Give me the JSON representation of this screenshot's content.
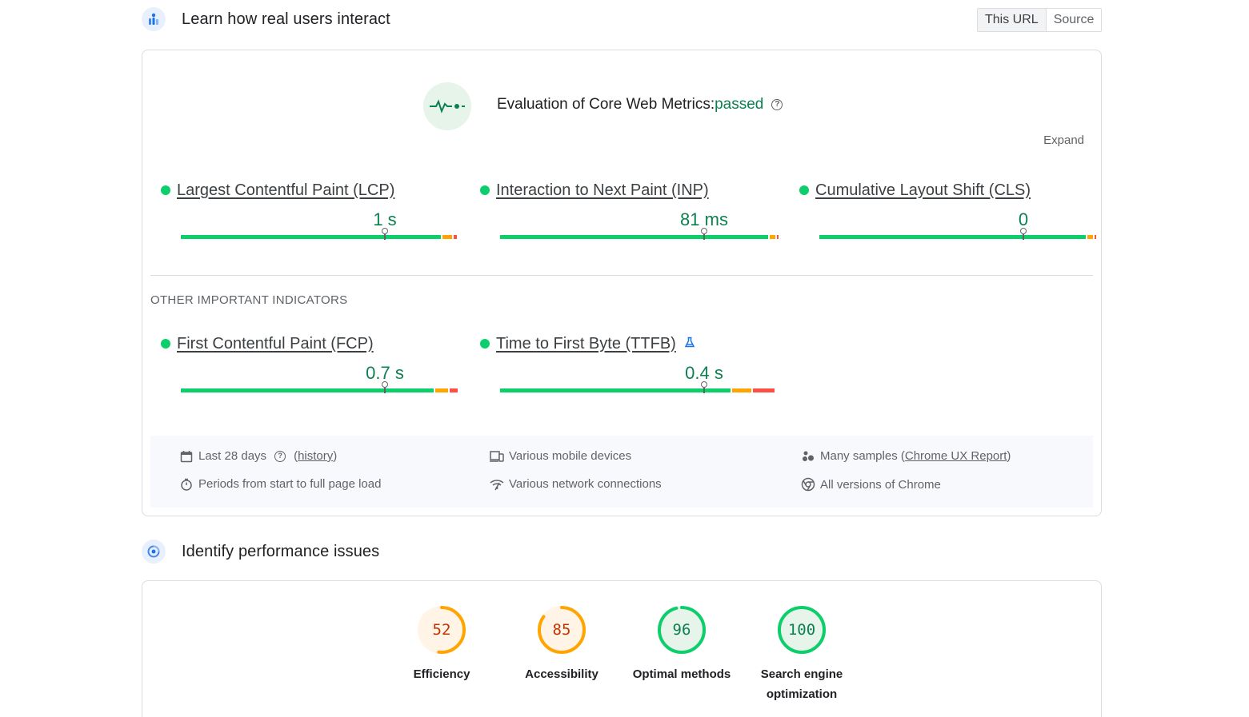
{
  "field_section": {
    "title": "Learn how real users interact",
    "tabs": [
      {
        "label": "This URL",
        "active": true
      },
      {
        "label": "Source",
        "active": false
      }
    ]
  },
  "evaluation": {
    "title": "Evaluation of Core Web Metrics:",
    "status": "passed",
    "help": "?",
    "expand_label": "Expand"
  },
  "core_metrics": [
    {
      "name": "Largest Contentful Paint (LCP)",
      "value": "1 s",
      "status": "good"
    },
    {
      "name": "Interaction to Next Paint (INP)",
      "value": "81 ms",
      "status": "good"
    },
    {
      "name": "Cumulative Layout Shift (CLS)",
      "value": "0",
      "status": "good"
    }
  ],
  "other_label": "OTHER IMPORTANT INDICATORS",
  "other_metrics": [
    {
      "name": "First Contentful Paint (FCP)",
      "value": "0.7 s",
      "status": "good"
    },
    {
      "name": "Time to First Byte (TTFB)",
      "value": "0.4 s",
      "status": "good",
      "experimental_icon": "flask-icon"
    }
  ],
  "info": {
    "period_prefix": "Last 28 days",
    "period_link": "history",
    "devices": "Various mobile devices",
    "samples_prefix": "Many samples (",
    "samples_link": "Chrome UX Report",
    "samples_suffix": ")",
    "load": "Periods from start to full page load",
    "network": "Various network connections",
    "chrome": "All versions of Chrome"
  },
  "lab_section": {
    "title": "Identify performance issues"
  },
  "scores": [
    {
      "score": "52",
      "label": "Efficiency",
      "level": "average"
    },
    {
      "score": "85",
      "label": "Accessibility",
      "level": "average"
    },
    {
      "score": "96",
      "label": "Optimal methods",
      "level": "good"
    },
    {
      "score": "100",
      "label": "Search engine optimization",
      "level": "good"
    }
  ],
  "colors": {
    "good": "#0cce6b",
    "good_text": "#0d8050",
    "average": "#ffa400",
    "average_text": "#c33300",
    "poor": "#ff4e42",
    "accent": "#1a73e8"
  }
}
